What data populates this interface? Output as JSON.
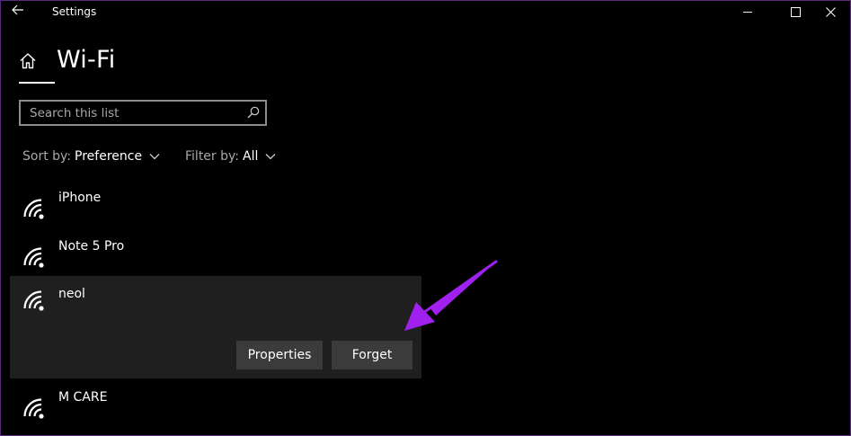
{
  "window": {
    "app_title": "Settings",
    "back_icon": "back-arrow-icon"
  },
  "header": {
    "title": "Wi-Fi",
    "home_icon": "home-icon"
  },
  "search": {
    "placeholder": "Search this list",
    "value": ""
  },
  "sort": {
    "label": "Sort by:",
    "value": "Preference"
  },
  "filter": {
    "label": "Filter by:",
    "value": "All"
  },
  "networks": [
    {
      "name": "iPhone",
      "expanded": false
    },
    {
      "name": "Note 5 Pro",
      "expanded": false
    },
    {
      "name": "neol",
      "expanded": true
    },
    {
      "name": "M CARE",
      "expanded": false
    }
  ],
  "actions": {
    "properties_label": "Properties",
    "forget_label": "Forget"
  },
  "colors": {
    "background": "#000000",
    "expanded_row": "#1f1f1f",
    "button": "#3b3b3b",
    "annotation_arrow": "#a020f0"
  }
}
